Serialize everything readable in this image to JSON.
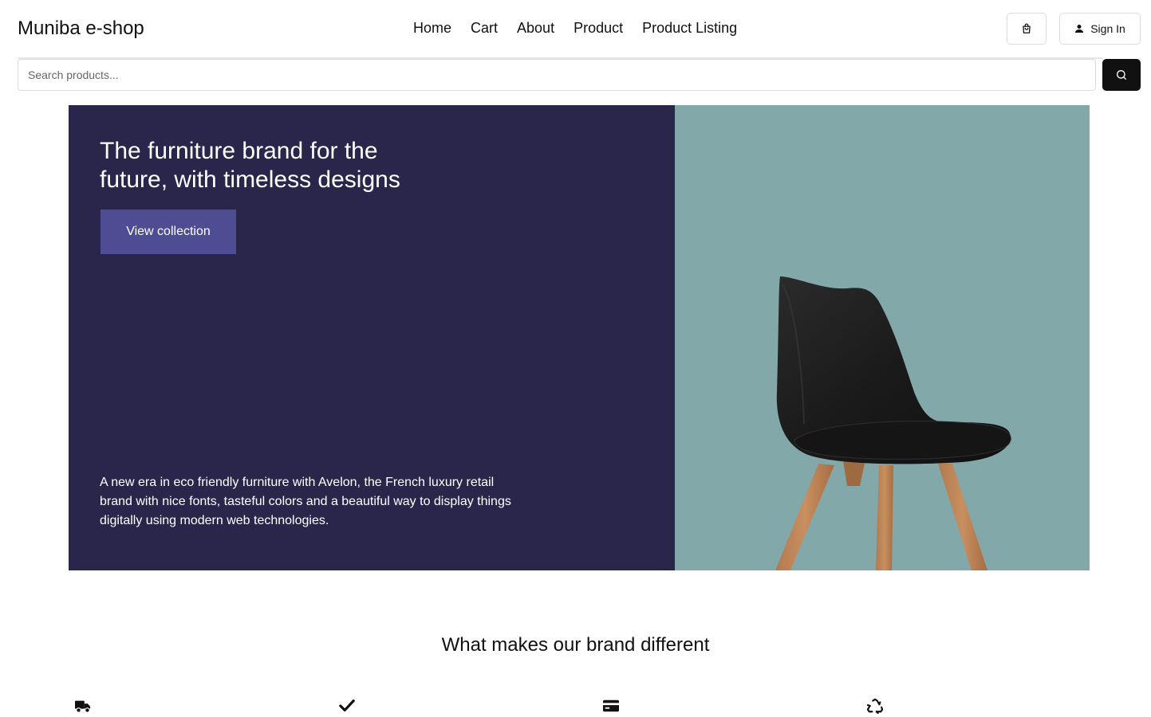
{
  "header": {
    "brand": "Muniba e-shop",
    "nav": [
      "Home",
      "Cart",
      "About",
      "Product",
      "Product Listing"
    ],
    "cart_icon": "shopping-bag-icon",
    "signin_label": "Sign In",
    "signin_icon": "user-icon"
  },
  "search": {
    "placeholder": "Search products...",
    "value": "",
    "button_icon": "search-icon"
  },
  "hero": {
    "title": "The furniture brand for the future, with timeless designs",
    "cta_label": "View collection",
    "description": "A new era in eco friendly furniture with Avelon, the French luxury retail brand with nice fonts, tasteful colors and a beautiful way to display things digitally using modern web technologies.",
    "image": "black-chair-image",
    "colors": {
      "left_bg": "#2a254b",
      "cta_bg": "#4e4d93",
      "right_bg": "#83a8aa"
    }
  },
  "features": {
    "title": "What makes our brand different",
    "icons": [
      "truck-icon",
      "checkmark-icon",
      "credit-card-icon",
      "recycle-icon"
    ]
  }
}
